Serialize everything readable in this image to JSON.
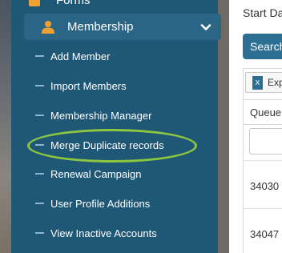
{
  "sidebar": {
    "top_item_label": "Forms",
    "section": {
      "label": "Membership",
      "icon": "user-icon",
      "chevron": "chevron-down-icon"
    },
    "items": [
      {
        "label": "Add Member"
      },
      {
        "label": "Import Members"
      },
      {
        "label": "Membership Manager"
      },
      {
        "label": "Merge Duplicate records",
        "highlighted": true
      },
      {
        "label": "Renewal Campaign"
      },
      {
        "label": "User Profile Additions"
      },
      {
        "label": "View Inactive Accounts"
      }
    ]
  },
  "main": {
    "start_label": "Start Da",
    "search_label": "Search",
    "export_label": "Exp",
    "queue_header": "Queue",
    "rows": [
      "34030",
      "34047"
    ]
  },
  "colors": {
    "sidebar_bg": "#1f5877",
    "section_bg": "#2a6585",
    "accent_orange": "#f0a030",
    "highlight_green": "#8dc63f",
    "button_blue": "#2d6f92"
  }
}
